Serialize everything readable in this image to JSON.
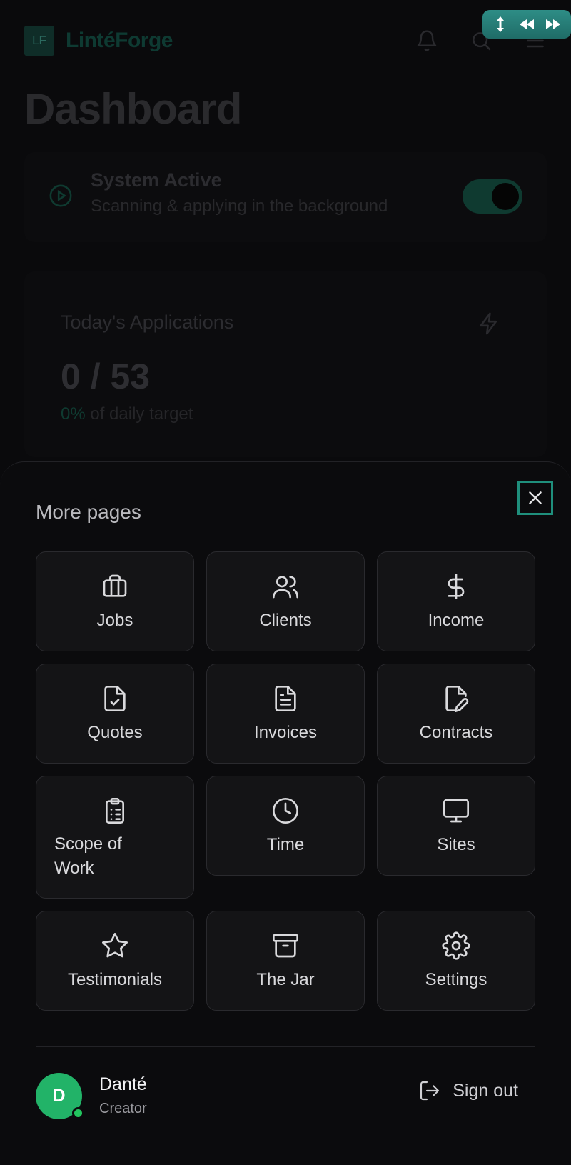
{
  "app": {
    "logo_initials": "LF",
    "brand_name": "LintéForge",
    "page_title": "Dashboard"
  },
  "status": {
    "title": "System Active",
    "subtitle": "Scanning & applying in the background",
    "toggle_on": true
  },
  "applications": {
    "title": "Today's Applications",
    "value": "0 / 53",
    "percent": "0%",
    "suffix": " of daily target"
  },
  "sheet": {
    "title": "More pages",
    "items": [
      {
        "label": "Jobs",
        "icon": "briefcase-icon"
      },
      {
        "label": "Clients",
        "icon": "users-icon"
      },
      {
        "label": "Income",
        "icon": "dollar-icon"
      },
      {
        "label": "Quotes",
        "icon": "file-check-icon"
      },
      {
        "label": "Invoices",
        "icon": "file-text-icon"
      },
      {
        "label": "Contracts",
        "icon": "file-signature-icon"
      },
      {
        "label": "Scope of\nWork",
        "icon": "clipboard-list-icon"
      },
      {
        "label": "Time",
        "icon": "clock-icon"
      },
      {
        "label": "Sites",
        "icon": "monitor-icon"
      },
      {
        "label": "Testimonials",
        "icon": "star-icon"
      },
      {
        "label": "The Jar",
        "icon": "archive-icon"
      },
      {
        "label": "Settings",
        "icon": "gear-icon"
      }
    ]
  },
  "user": {
    "initial": "D",
    "name": "Danté",
    "role": "Creator",
    "online": true
  },
  "signout_label": "Sign out",
  "colors": {
    "accent": "#22b368",
    "close_border": "#1f8f7c",
    "sheet_bg": "#0b0b0d",
    "tile_bg": "#141416"
  }
}
